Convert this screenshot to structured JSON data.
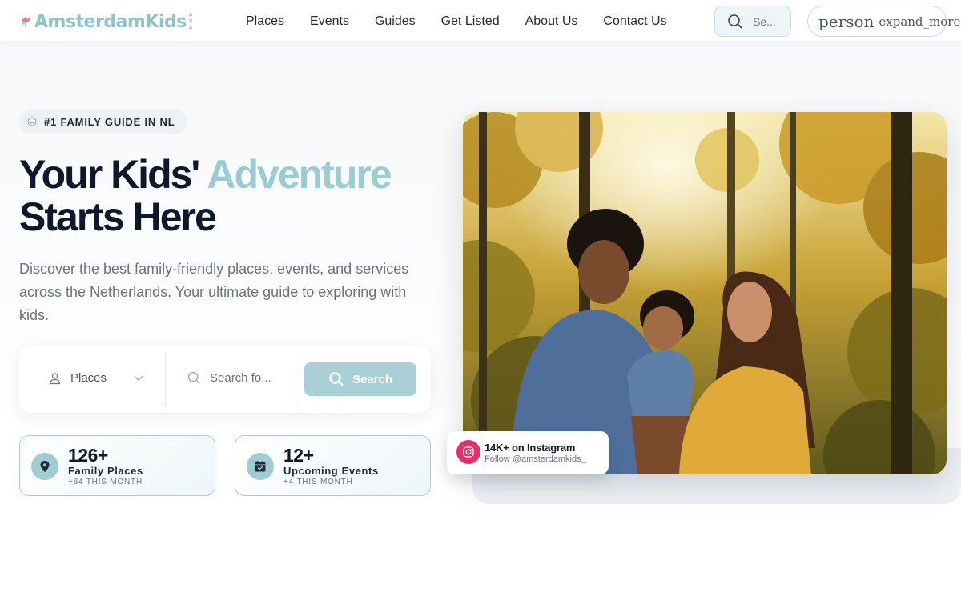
{
  "brand": {
    "logo_text": "AmsterdamKids",
    "logo_mark": "xxx",
    "logo_icon": "tulip-icon",
    "accent_color": "#9ccbd2",
    "brand_pink": "#e27f88"
  },
  "nav": {
    "items": [
      {
        "label": "Places"
      },
      {
        "label": "Events"
      },
      {
        "label": "Guides"
      },
      {
        "label": "Get Listed"
      },
      {
        "label": "About Us"
      },
      {
        "label": "Contact Us"
      }
    ]
  },
  "header_search": {
    "icon": "search-icon",
    "placeholder": "Se..."
  },
  "account": {
    "icon_text": "person",
    "chevron_text": "expand_more"
  },
  "hero": {
    "badge": {
      "icon": "smile-icon",
      "text": "#1 FAMILY GUIDE IN NL"
    },
    "headline_part1": "Your Kids'",
    "headline_accent": "Adventure",
    "headline_part2": "Starts Here",
    "subtext": "Discover the best family-friendly places, events, and services across the Netherlands. Your ultimate guide to exploring with kids."
  },
  "search_card": {
    "category_icon": "map-pin-user-icon",
    "category_selected": "Places",
    "input_placeholder": "Search fo...",
    "button_label": "Search",
    "button_color": "#a9d0d6"
  },
  "stats": [
    {
      "icon": "location-pin-icon",
      "number": "126+",
      "label": "Family Places",
      "sub": "+84 THIS MONTH"
    },
    {
      "icon": "calendar-check-icon",
      "number": "12+",
      "label": "Upcoming Events",
      "sub": "+4 THIS MONTH"
    }
  ],
  "instagram": {
    "icon": "instagram-icon",
    "title": "14K+ on Instagram",
    "handle": "Follow @amsterdamkids_",
    "color": "#e1306c"
  },
  "hero_image": {
    "subject": "family-in-forest-photo"
  }
}
